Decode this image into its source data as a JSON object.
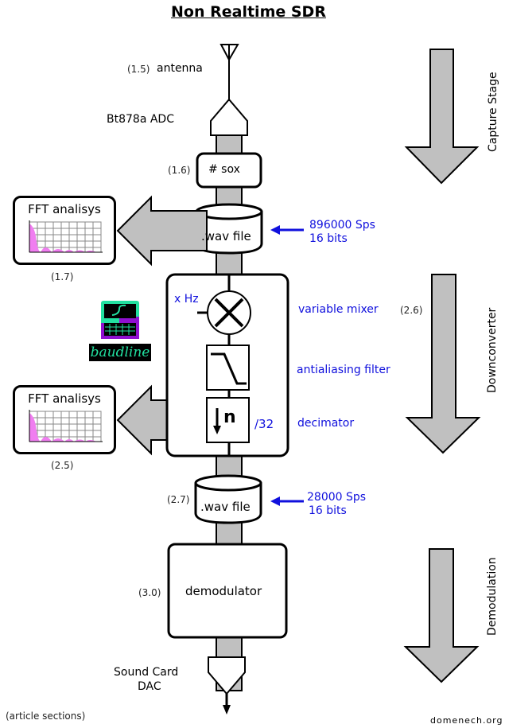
{
  "title": "Non Realtime SDR",
  "capture": {
    "antenna_section": "(1.5)",
    "antenna_label": "antenna",
    "adc_label": "Bt878a ADC",
    "sox_section": "(1.6)",
    "sox_label": "# sox",
    "wav1_label": ".wav file",
    "wav1_rate": "896000 Sps",
    "wav1_bits": "16 bits",
    "fft1_title": "FFT analisys",
    "fft1_section": "(1.7)"
  },
  "downconverter": {
    "mixer_freq": "x Hz",
    "mixer_label": "variable mixer",
    "mixer_section": "(2.6)",
    "filter_label": "antialiasing filter",
    "decimator_symbol": "n",
    "decimator_factor": "/32",
    "decimator_label": "decimator",
    "baudline_label": "baudline",
    "fft2_title": "FFT analisys",
    "fft2_section": "(2.5)",
    "wav2_section": "(2.7)",
    "wav2_label": ".wav file",
    "wav2_rate": "28000 Sps",
    "wav2_bits": "16 bits"
  },
  "demod": {
    "section": "(3.0)",
    "label": "demodulator",
    "dac_line1": "Sound Card",
    "dac_line2": "DAC"
  },
  "stages": [
    "Capture Stage",
    "Downconverter",
    "Demodulation"
  ],
  "footer": {
    "note": "(article sections)",
    "credit": "domenech.org"
  },
  "colors": {
    "pipe_gray": "#c0c0c0",
    "annotation_blue": "#1010dd",
    "fft_pink": "#f07ef0",
    "baudline_green": "#22e0a0",
    "baudline_purple": "#9010d0"
  }
}
